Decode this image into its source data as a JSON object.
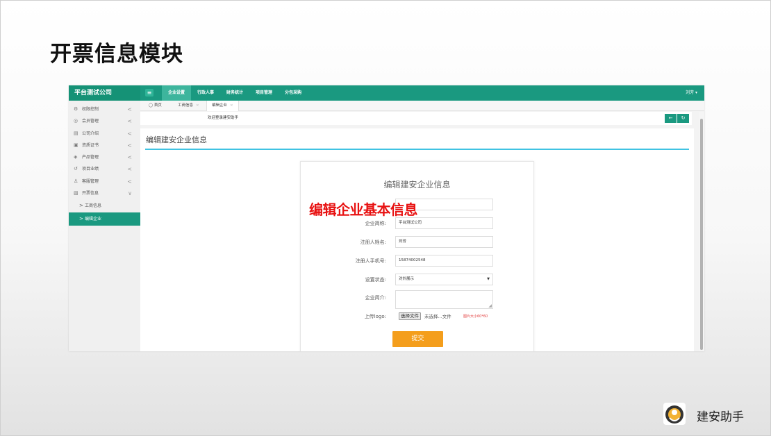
{
  "slide": {
    "title": "开票信息模块"
  },
  "app": {
    "brand": "平台测试公司",
    "menu_toggle_icon": "hamburger-icon",
    "topnav": [
      "企业设置",
      "行政人事",
      "财务统计",
      "项目管理",
      "分包采购"
    ],
    "topnav_active_index": 0,
    "user": "刘芳 ▾",
    "sidebar": {
      "items": [
        {
          "label": "权限控制",
          "icon": "settings-icon",
          "chevron": "<"
        },
        {
          "label": "会员管理",
          "icon": "user-icon",
          "chevron": "<"
        },
        {
          "label": "公司介绍",
          "icon": "document-icon",
          "chevron": "<"
        },
        {
          "label": "资质证书",
          "icon": "certificate-icon",
          "chevron": "<"
        },
        {
          "label": "产品管理",
          "icon": "box-icon",
          "chevron": "<"
        },
        {
          "label": "项目业绩",
          "icon": "history-icon",
          "chevron": "<"
        },
        {
          "label": "客服管理",
          "icon": "service-icon",
          "chevron": "<"
        },
        {
          "label": "开票信息",
          "icon": "invoice-icon",
          "chevron": "∨"
        }
      ],
      "subitems": [
        {
          "label": "工商信息",
          "arrow": ">"
        },
        {
          "label": "编辑企业",
          "arrow": ">"
        }
      ]
    },
    "tabs": [
      {
        "label": "◯ 首页"
      },
      {
        "label": "工商信息",
        "close": "×"
      },
      {
        "label": "编辑企业",
        "close": "×"
      }
    ],
    "welcome": "欢迎登录建安助手",
    "nav_buttons": [
      "←",
      "↻"
    ],
    "page_title": "编辑建安企业信息",
    "form": {
      "title": "编辑建安企业信息",
      "fields": {
        "company_name": {
          "label": "企业简称:",
          "value": "平台测试公司"
        },
        "registrant_name": {
          "label": "注册人姓名:",
          "value": "刘芳"
        },
        "registrant_phone": {
          "label": "注册人手机号:",
          "value": "15874002548"
        },
        "status": {
          "label": "设置状态:",
          "value": "对外展示",
          "caret": "▼"
        },
        "intro": {
          "label": "企业简介:",
          "value": ""
        },
        "logo": {
          "label": "上传logo:",
          "button": "选择文件",
          "status": "未选择...文件",
          "hint": "图片大小60*60"
        }
      },
      "submit": "提交"
    }
  },
  "annotation": {
    "text": "编辑企业基本信息",
    "color": "#e81212"
  },
  "footer": {
    "logo_icon": "jianan-logo-icon",
    "name": "建安助手"
  },
  "colors": {
    "primary": "#1a9980",
    "accent_line": "#40c3e2",
    "submit": "#f49e1c",
    "hint_red": "#e23c3c"
  }
}
